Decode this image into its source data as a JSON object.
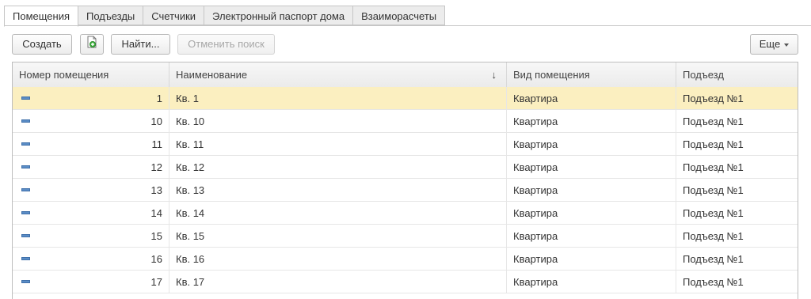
{
  "tabs": [
    {
      "label": "Помещения",
      "active": true
    },
    {
      "label": "Подъезды",
      "active": false
    },
    {
      "label": "Счетчики",
      "active": false
    },
    {
      "label": "Электронный паспорт дома",
      "active": false
    },
    {
      "label": "Взаиморасчеты",
      "active": false
    }
  ],
  "toolbar": {
    "create_label": "Создать",
    "copy_icon": "copy-document-icon",
    "find_label": "Найти...",
    "cancel_search_label": "Отменить поиск",
    "more_label": "Еще"
  },
  "table": {
    "columns": [
      "Номер помещения",
      "Наименование",
      "Вид помещения",
      "Подъезд"
    ],
    "sort_indicator": "↓",
    "rows": [
      {
        "number": "1",
        "name": "Кв. 1",
        "type": "Квартира",
        "entrance": "Подъезд №1",
        "selected": true
      },
      {
        "number": "10",
        "name": "Кв. 10",
        "type": "Квартира",
        "entrance": "Подъезд №1",
        "selected": false
      },
      {
        "number": "11",
        "name": "Кв. 11",
        "type": "Квартира",
        "entrance": "Подъезд №1",
        "selected": false
      },
      {
        "number": "12",
        "name": "Кв. 12",
        "type": "Квартира",
        "entrance": "Подъезд №1",
        "selected": false
      },
      {
        "number": "13",
        "name": "Кв. 13",
        "type": "Квартира",
        "entrance": "Подъезд №1",
        "selected": false
      },
      {
        "number": "14",
        "name": "Кв. 14",
        "type": "Квартира",
        "entrance": "Подъезд №1",
        "selected": false
      },
      {
        "number": "15",
        "name": "Кв. 15",
        "type": "Квартира",
        "entrance": "Подъезд №1",
        "selected": false
      },
      {
        "number": "16",
        "name": "Кв. 16",
        "type": "Квартира",
        "entrance": "Подъезд №1",
        "selected": false
      },
      {
        "number": "17",
        "name": "Кв. 17",
        "type": "Квартира",
        "entrance": "Подъезд №1",
        "selected": false
      }
    ]
  },
  "colors": {
    "selected_row": "#fbefc0",
    "row_icon": "#5b8dc6"
  }
}
